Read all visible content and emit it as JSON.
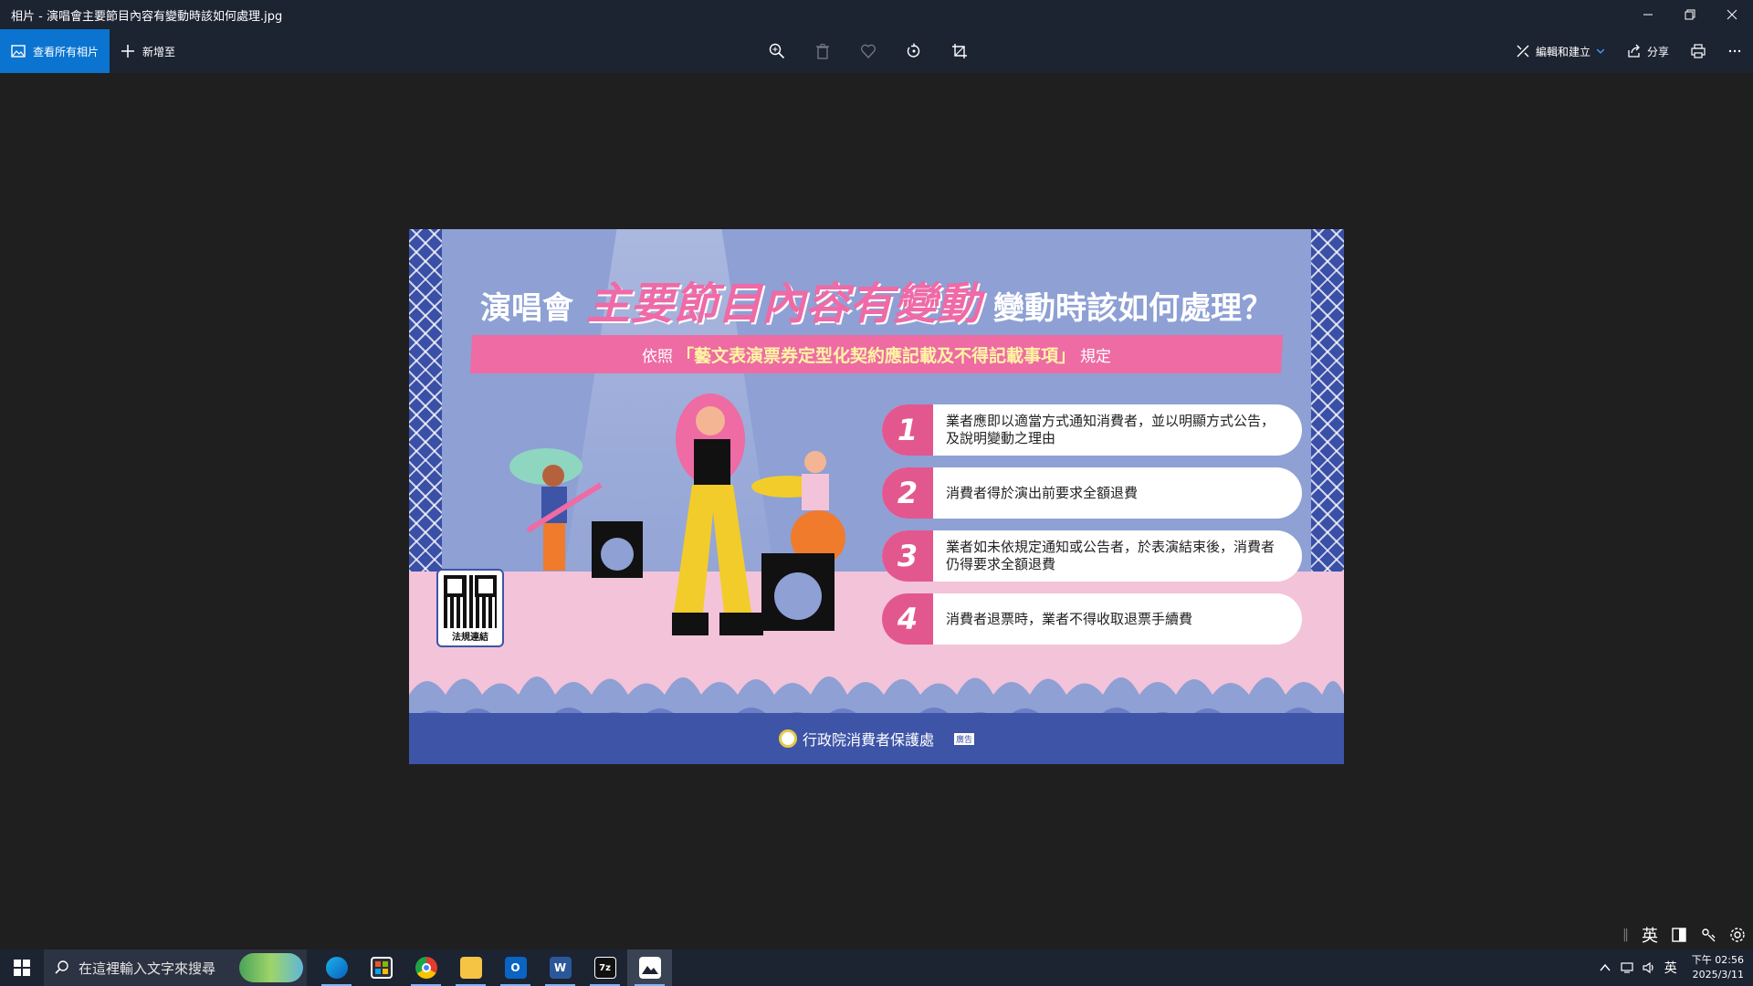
{
  "window": {
    "title": "相片 - 演唱會主要節目內容有變動時該如何處理.jpg"
  },
  "toolbar": {
    "view_all_label": "查看所有相片",
    "add_to_label": "新增至",
    "edit_create_label": "編輯和建立",
    "share_label": "分享"
  },
  "poster": {
    "title_prefix": "演唱會",
    "title_highlight": "主要節目內容有變動",
    "title_suffix": "變動時該如何處理？",
    "ribbon_prefix": "依照",
    "ribbon_law": "「藝文表演票券定型化契約應記載及不得記載事項」",
    "ribbon_suffix": "規定",
    "items": [
      {
        "num": "1",
        "text": "業者應即以適當方式通知消費者，並以明顯方式公告，及說明變動之理由"
      },
      {
        "num": "2",
        "text": "消費者得於演出前要求全額退費"
      },
      {
        "num": "3",
        "text": "業者如未依規定通知或公告者，於表演結束後，消費者仍得要求全額退費"
      },
      {
        "num": "4",
        "text": "消費者退票時，業者不得收取退票手續費"
      }
    ],
    "qr_label": "法規連結",
    "agency": "行政院消費者保護處",
    "ad_tag": "廣告"
  },
  "taskbar": {
    "search_placeholder": "在這裡輸入文字來搜尋",
    "ime_label": "英",
    "clock_time": "下午 02:56",
    "clock_date": "2025/3/11"
  },
  "colors": {
    "accent": "#0a74d0",
    "poster_pink": "#e3578f",
    "poster_blue": "#3d54a7",
    "poster_bg": "#8ea0d4"
  }
}
